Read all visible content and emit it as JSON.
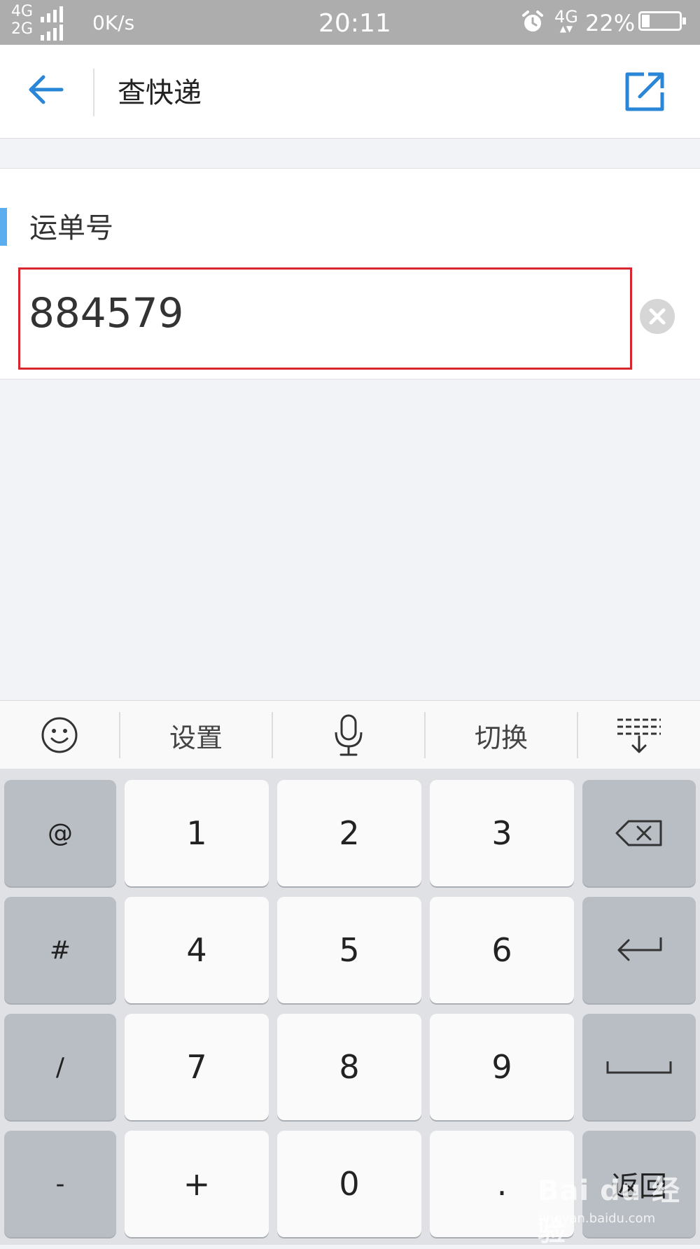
{
  "status_bar": {
    "network_top": "4G",
    "network_bottom": "2G",
    "speed": "0K/s",
    "time": "20:11",
    "data_type": "4G",
    "battery_percent": "22%",
    "icons": [
      "signal-icon",
      "alarm-icon",
      "battery-icon"
    ]
  },
  "header": {
    "title": "查快递",
    "back_icon": "back-arrow-icon",
    "edit_icon": "edit-open-icon",
    "accent_color": "#2a86d6"
  },
  "form": {
    "label": "运单号",
    "tracking_number": "884579",
    "clear_icon": "clear-icon",
    "highlight_color": "#d8262e"
  },
  "keyboard_toolbar": {
    "items": [
      "emoji-icon",
      "设置",
      "mic-icon",
      "切换",
      "hide-keyboard-icon"
    ],
    "settings_label": "设置",
    "switch_label": "切换"
  },
  "keyboard": {
    "rows": [
      [
        "@",
        "1",
        "2",
        "3",
        "backspace-icon"
      ],
      [
        "#",
        "4",
        "5",
        "6",
        "enter-icon"
      ],
      [
        "/",
        "7",
        "8",
        "9",
        "space-icon"
      ],
      [
        "-",
        "+",
        "0",
        ".",
        "返回"
      ]
    ],
    "return_label": "返回"
  },
  "watermark": {
    "brand": "Bai du 经验",
    "url": "jingyan.baidu.com"
  }
}
